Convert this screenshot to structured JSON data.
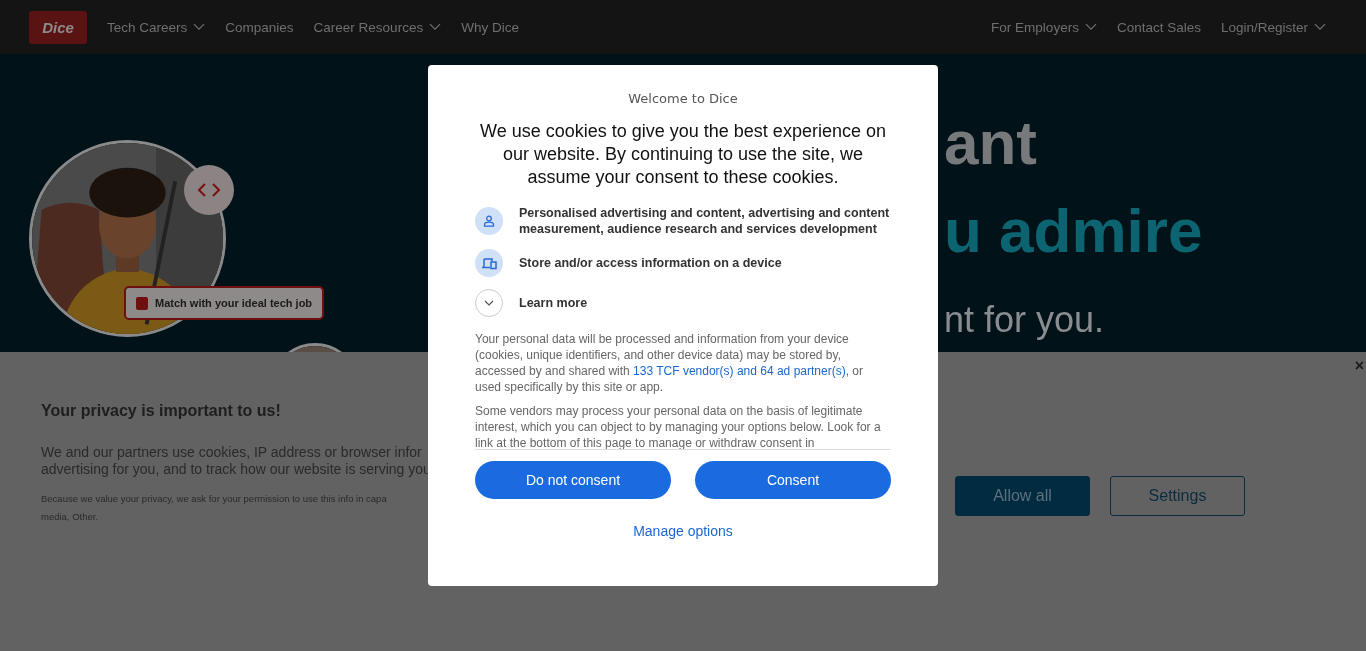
{
  "header": {
    "logo": "Dice",
    "nav_left": [
      {
        "label": "Tech Careers",
        "dropdown": true
      },
      {
        "label": "Companies",
        "dropdown": false
      },
      {
        "label": "Career Resources",
        "dropdown": true
      },
      {
        "label": "Why Dice",
        "dropdown": false
      }
    ],
    "nav_right": [
      {
        "label": "For Employers",
        "dropdown": true
      },
      {
        "label": "Contact Sales",
        "dropdown": false
      },
      {
        "label": "Login/Register",
        "dropdown": true
      }
    ]
  },
  "hero": {
    "tag": "Match with your ideal tech job",
    "headline": [
      {
        "text": "ant",
        "kind": "title"
      },
      {
        "text": "u admire",
        "kind": "accent"
      },
      {
        "text": "nt for you.",
        "kind": "sub"
      }
    ]
  },
  "privacy_banner": {
    "close": "×",
    "title": "Your privacy is important to us!",
    "body_lines": [
      "We and our partners use cookies, IP address or browser infor",
      "advertising for you, and to track how our website is serving you"
    ],
    "fine_print_lines": [
      "Because we value your privacy, we ask for your permission to use this info in capa",
      "media, Other."
    ],
    "buttons": [
      {
        "label": "Allow all",
        "kind": "primary"
      },
      {
        "label": "Settings",
        "kind": "secondary"
      }
    ]
  },
  "consent_dialog": {
    "title": "Welcome to Dice",
    "heading": "We use cookies to give you the best experience on our website. By continuing to use the site, we assume your consent to these cookies.",
    "purposes": [
      {
        "kind": "person",
        "text": "Personalised advertising and content, advertising and content measurement, audience research and services development"
      },
      {
        "kind": "device",
        "text": "Store and/or access information on a device"
      }
    ],
    "learn_more": {
      "label": "Learn more",
      "expanded": false
    },
    "paragraphs": [
      {
        "before": "Your personal data will be processed and information from your device (cookies, unique identifiers, and other device data) may be stored by, accessed by and shared with ",
        "link": "133 TCF vendor(s) and 64 ad partner(s)",
        "after": ", or used specifically by this site or app."
      },
      {
        "before": "Some vendors may process your personal data on the basis of legitimate interest, which you can object to by managing your options below. Look for a link at the bottom of this page to manage or withdraw consent in"
      }
    ],
    "buttons": [
      "Do not consent",
      "Consent"
    ],
    "manage_options": "Manage options"
  }
}
